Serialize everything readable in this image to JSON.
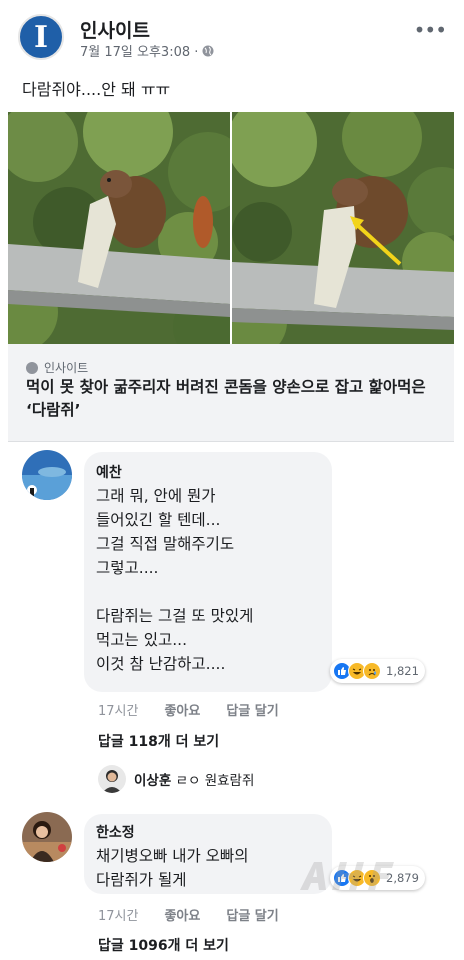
{
  "post": {
    "page_name": "인사이트",
    "logo_letter": "I",
    "timestamp": "7월 17일 오후3:08 ·",
    "text": "다람쥐야....안 돼 ㅠㅠ",
    "more_icon": "more-horizontal-icon",
    "privacy_icon": "globe-icon"
  },
  "link_preview": {
    "source": "인사이트",
    "title": "먹이 못 찾아 굶주리자 버려진 콘돔을 양손으로 잡고 핥아먹은 ‘다람쥐’"
  },
  "comments": [
    {
      "name": "예찬",
      "text": "그래 뭐, 안에 뭔가\n들어있긴 할 텐데...\n그걸 직접 말해주기도\n그렇고....\n\n다람쥐는 그걸 또 맛있게\n먹고는 있고...\n이것 참 난감하고....",
      "reaction_count": "1,821",
      "reactions": [
        "like-icon",
        "haha-icon",
        "sad-icon"
      ],
      "time": "17시간",
      "like_label": "좋아요",
      "reply_label": "답글 달기",
      "more_replies": "답글 118개 더 보기"
    },
    {
      "name": "한소정",
      "text": "채기병오빠 내가 오빠의\n다람쥐가 될게",
      "reaction_count": "2,879",
      "reactions": [
        "like-icon",
        "haha-icon",
        "wow-icon"
      ],
      "time": "17시간",
      "like_label": "좋아요",
      "reply_label": "답글 달기",
      "more_replies": "답글 1096개 더 보기"
    }
  ],
  "reply_preview": {
    "name": "이상훈",
    "text": "ㄹㅇ 원효람쥐"
  },
  "colors": {
    "logo": "#1f5fa8",
    "bubble": "#f2f3f5",
    "like": "#1877f2",
    "haha": "#f7b928"
  }
}
